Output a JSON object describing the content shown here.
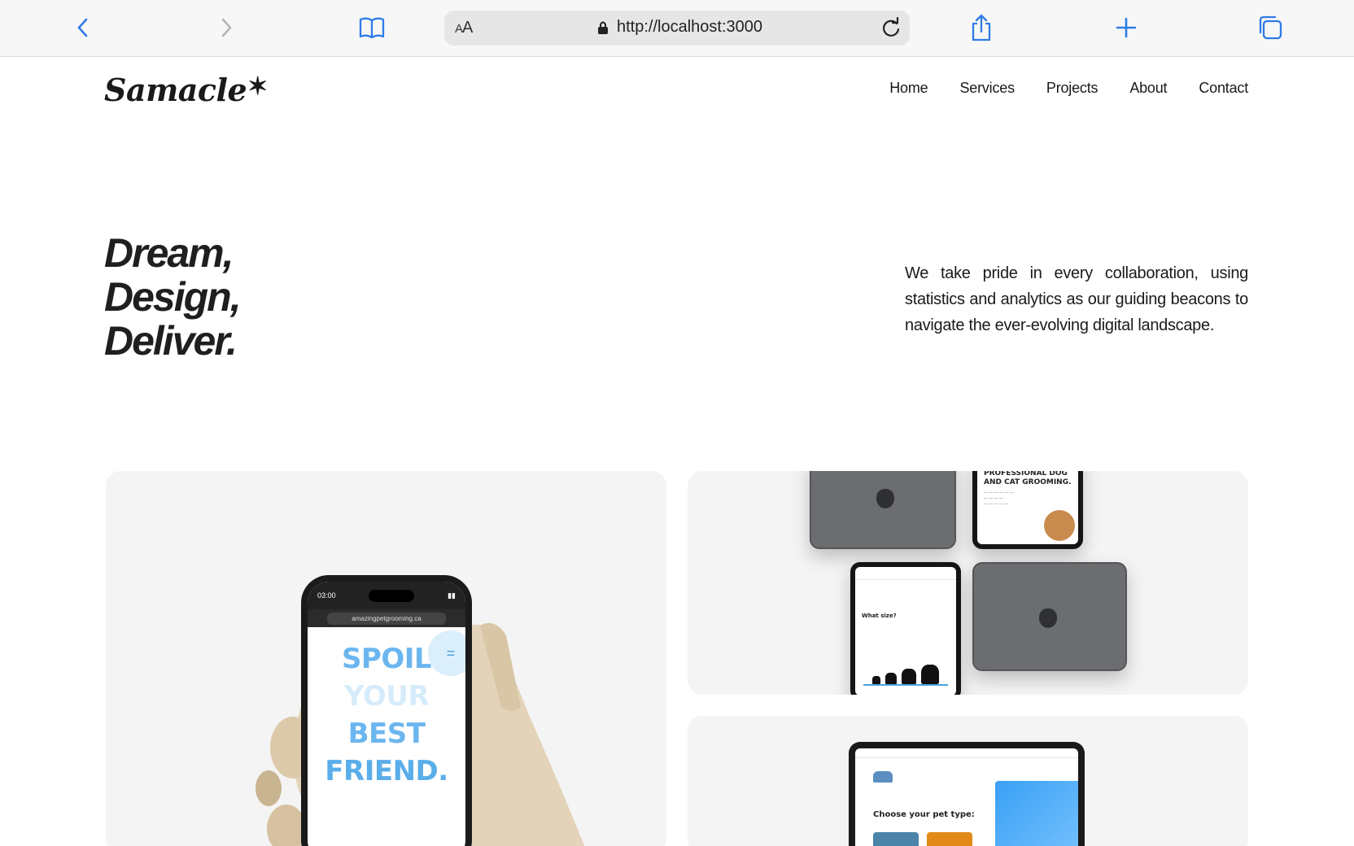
{
  "browser": {
    "reader_label": "AA",
    "url": "http://localhost:3000",
    "accent": "#2f7be6"
  },
  "site": {
    "logo": "Samacle",
    "logo_mark": "✶",
    "nav": [
      "Home",
      "Services",
      "Projects",
      "About",
      "Contact"
    ]
  },
  "hero": {
    "title_lines": [
      "Dream,",
      "Design,",
      "Deliver."
    ],
    "description": "We take pride in every collaboration, using statistics and analytics as our guiding beacons to navigate the ever-evolving digital landscape."
  },
  "projects": {
    "phone": {
      "status_time": "03:00",
      "url": "amazingpetgrooming.ca",
      "headline": [
        "SPOIL",
        "YOUR",
        "BEST",
        "FRIEND."
      ]
    },
    "ipads": {
      "headline": "PROFESSIONAL DOG AND CAT GROOMING.",
      "question": "What size?"
    },
    "laptop": {
      "heading": "Choose your pet type:"
    }
  }
}
